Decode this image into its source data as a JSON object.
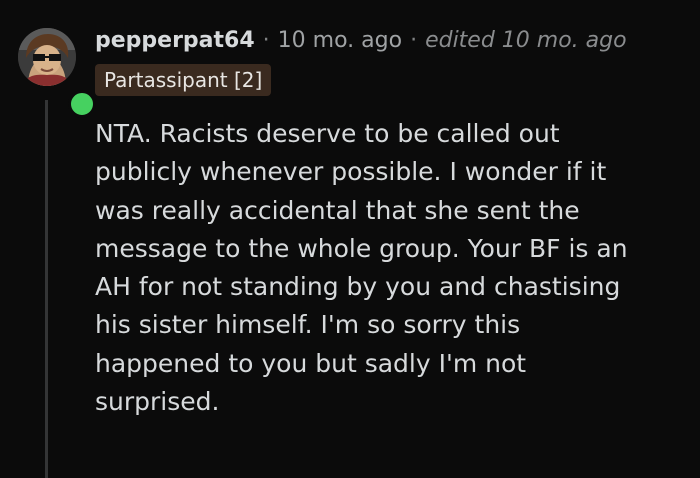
{
  "comment": {
    "username": "pepperpat64",
    "separator": "·",
    "time": "10 mo. ago",
    "edited": "edited 10 mo. ago",
    "flair": "Partassipant [2]",
    "avatar_icon": "avatar-icon",
    "online_status_color": "#46d160",
    "body_lines": [
      "NTA. Racists deserve to be called out",
      "publicly whenever possible. I wonder if it",
      "was really accidental that she sent the",
      "message to the whole group. Your BF is an",
      "AH for not standing by you and chastising",
      "his sister himself. I'm so sorry this",
      "happened to you but sadly I'm not",
      "surprised."
    ]
  }
}
